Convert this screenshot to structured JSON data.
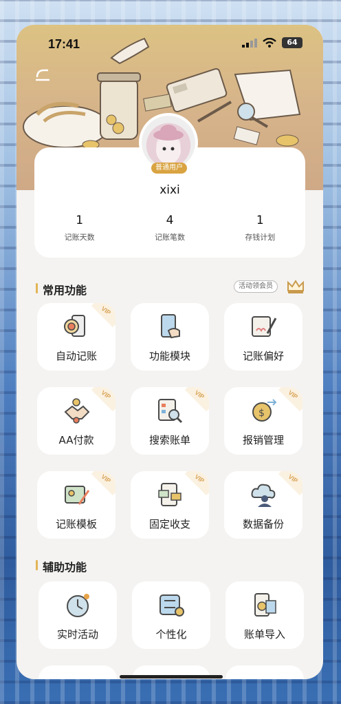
{
  "status_bar": {
    "time": "17:41",
    "battery": "64"
  },
  "profile": {
    "badge": "普通用户",
    "username": "xixi",
    "stats": [
      {
        "value": "1",
        "label": "记账天数"
      },
      {
        "value": "4",
        "label": "记账笔数"
      },
      {
        "value": "1",
        "label": "存钱计划"
      }
    ]
  },
  "common_section": {
    "title": "常用功能",
    "member_button": "活动领会员",
    "vip_tag": "VIP",
    "tiles": [
      {
        "label": "自动记账",
        "vip": true,
        "icon": "phone-target-icon"
      },
      {
        "label": "功能模块",
        "vip": false,
        "icon": "phone-hand-icon"
      },
      {
        "label": "记账偏好",
        "vip": false,
        "icon": "ledger-pen-icon"
      },
      {
        "label": "AA付款",
        "vip": true,
        "icon": "handshake-coins-icon"
      },
      {
        "label": "搜索账单",
        "vip": true,
        "icon": "search-doc-icon"
      },
      {
        "label": "报销管理",
        "vip": true,
        "icon": "coin-arrows-icon"
      },
      {
        "label": "记账模板",
        "vip": true,
        "icon": "template-pen-icon"
      },
      {
        "label": "固定收支",
        "vip": true,
        "icon": "fixed-money-icon"
      },
      {
        "label": "数据备份",
        "vip": true,
        "icon": "cloud-user-icon"
      }
    ]
  },
  "aux_section": {
    "title": "辅助功能",
    "tiles": [
      {
        "label": "实时活动",
        "icon": "clock-icon"
      },
      {
        "label": "个性化",
        "icon": "settings-gear-icon"
      },
      {
        "label": "账单导入",
        "icon": "bill-import-icon"
      }
    ]
  },
  "colors": {
    "accent": "#e2b457",
    "header": "#d7b58a",
    "badge": "#d9a341"
  }
}
